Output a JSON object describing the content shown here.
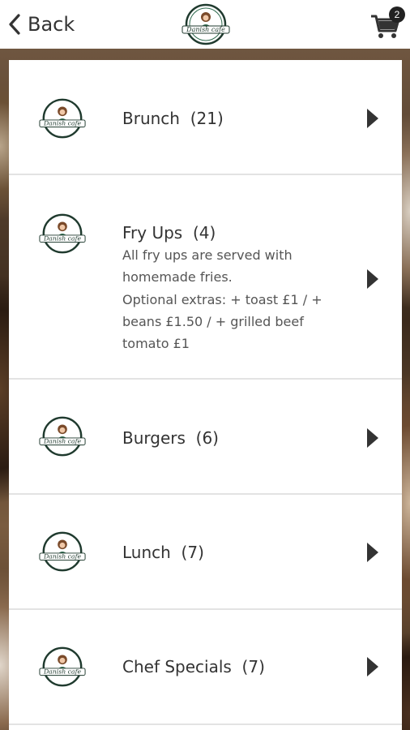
{
  "header": {
    "back_label": "Back",
    "logo_text": "Danish cafe",
    "cart_count": "2"
  },
  "categories": [
    {
      "title": "Brunch",
      "count": "(21)",
      "desc": []
    },
    {
      "title": "Fry Ups",
      "count": "(4)",
      "desc": [
        "All fry ups are served with homemade fries.",
        "Optional extras: + toast £1 / + beans £1.50 / + grilled beef tomato £1"
      ]
    },
    {
      "title": "Burgers",
      "count": "(6)",
      "desc": []
    },
    {
      "title": "Lunch",
      "count": "(7)",
      "desc": []
    },
    {
      "title": "Chef Specials",
      "count": "(7)",
      "desc": []
    }
  ],
  "colors": {
    "logo_green": "#2f6b4f",
    "logo_dark": "#1f3a2e",
    "text": "#333333"
  }
}
